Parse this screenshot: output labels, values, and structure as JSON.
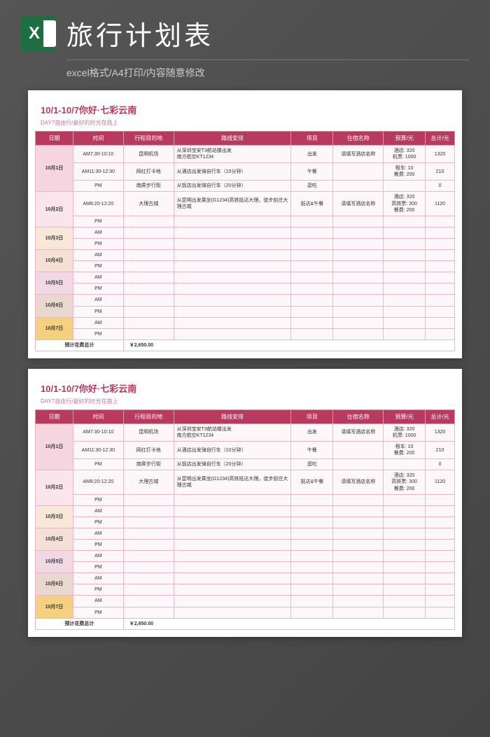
{
  "header": {
    "title": "旅行计划表",
    "subtitle": "excel格式/A4打印/内容随意修改"
  },
  "sheet": {
    "title": "10/1-10/7你好·七彩云南",
    "subtitle": "DAY7自由行/最好的时光在路上",
    "columns": [
      "日期",
      "时间",
      "行程目的地",
      "路线安排",
      "项目",
      "住宿名称",
      "预算/元",
      "总计/元"
    ],
    "rows": [
      {
        "date": "10月1日",
        "time": "AM7:30-10:10",
        "dest": "昆明机场",
        "route": "从深圳宝安T3航站楼出发\n南方航空KT1234",
        "item": "出发",
        "hotel": "请填写酒店名称",
        "budget": "酒店: 320\n机票: 1000",
        "total": "1320"
      },
      {
        "date": "",
        "time": "AM11:30-12:30",
        "dest": "网红打卡地",
        "route": "从酒店出发骑自行车（10分钟）",
        "item": "午餐",
        "hotel": "",
        "budget": "租车: 10\n餐费: 200",
        "total": "210"
      },
      {
        "date": "",
        "time": "PM",
        "dest": "南屏步行街",
        "route": "从饭店出发骑自行车（20分钟）",
        "item": "逛吃",
        "hotel": "",
        "budget": "",
        "total": "0"
      },
      {
        "date": "10月2日",
        "time": "AM8:20-12:20",
        "dest": "大理古城",
        "route": "从昆明出发乘坐(G1234)高铁抵达大理，徒步前往大理古城",
        "item": "抵达&午餐",
        "hotel": "请填写酒店名称",
        "budget": "酒店: 320\n高铁票: 300\n餐费: 200",
        "total": "1120"
      },
      {
        "date": "",
        "time": "PM",
        "dest": "",
        "route": "",
        "item": "",
        "hotel": "",
        "budget": "",
        "total": ""
      },
      {
        "date": "10月3日",
        "time": "AM",
        "dest": "",
        "route": "",
        "item": "",
        "hotel": "",
        "budget": "",
        "total": ""
      },
      {
        "date": "",
        "time": "PM",
        "dest": "",
        "route": "",
        "item": "",
        "hotel": "",
        "budget": "",
        "total": ""
      },
      {
        "date": "10月4日",
        "time": "AM",
        "dest": "",
        "route": "",
        "item": "",
        "hotel": "",
        "budget": "",
        "total": ""
      },
      {
        "date": "",
        "time": "PM",
        "dest": "",
        "route": "",
        "item": "",
        "hotel": "",
        "budget": "",
        "total": ""
      },
      {
        "date": "10月5日",
        "time": "AM",
        "dest": "",
        "route": "",
        "item": "",
        "hotel": "",
        "budget": "",
        "total": ""
      },
      {
        "date": "",
        "time": "PM",
        "dest": "",
        "route": "",
        "item": "",
        "hotel": "",
        "budget": "",
        "total": ""
      },
      {
        "date": "10月6日",
        "time": "AM",
        "dest": "",
        "route": "",
        "item": "",
        "hotel": "",
        "budget": "",
        "total": ""
      },
      {
        "date": "",
        "time": "PM",
        "dest": "",
        "route": "",
        "item": "",
        "hotel": "",
        "budget": "",
        "total": ""
      },
      {
        "date": "10月7日",
        "time": "AM",
        "dest": "",
        "route": "",
        "item": "",
        "hotel": "",
        "budget": "",
        "total": ""
      },
      {
        "date": "",
        "time": "PM",
        "dest": "",
        "route": "",
        "item": "",
        "hotel": "",
        "budget": "",
        "total": ""
      }
    ],
    "total_label": "预计花费总计",
    "total_value": "￥2,650.00"
  }
}
